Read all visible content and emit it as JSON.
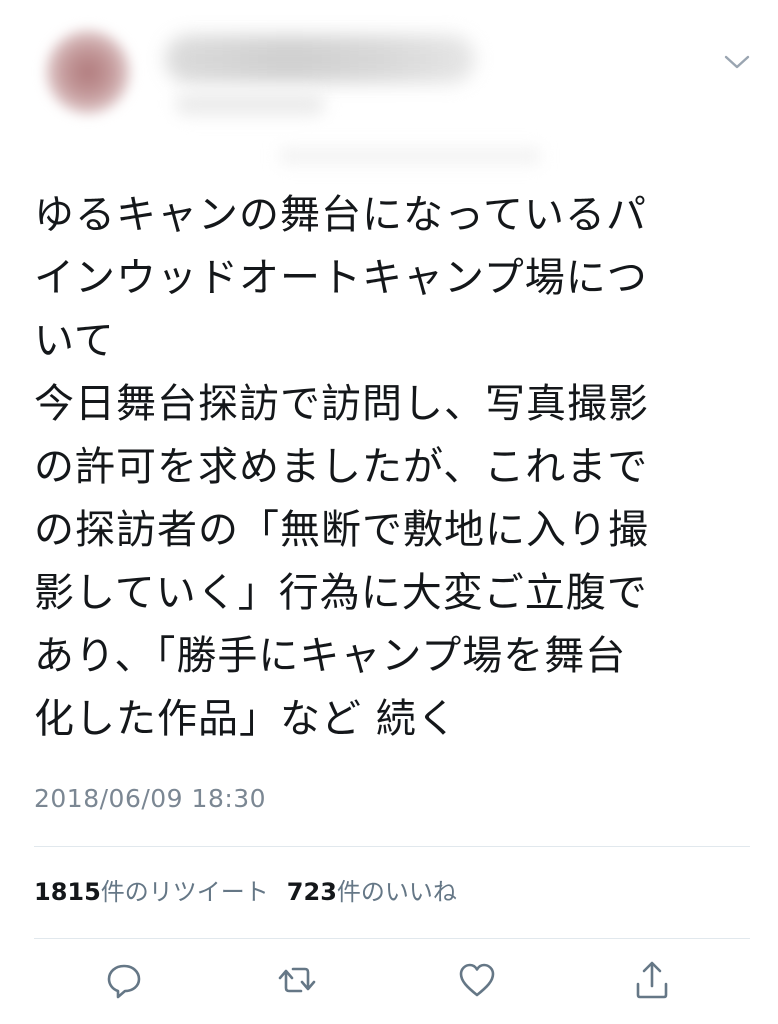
{
  "header": {
    "avatar_icon": "avatar-icon",
    "menu_icon": "chevron-down-icon"
  },
  "tweet": {
    "lines": [
      "ゆるキャンの舞台になっているパ",
      "インウッドオートキャンプ場につ",
      "いて",
      "今日舞台探訪で訪問し、写真撮影",
      "の許可を求めましたが、これまで",
      "の探訪者の「無断で敷地に入り撮",
      "影していく」行為に大変ご立腹で",
      "あり、「勝手にキャンプ場を舞台",
      "化した作品」など 続く"
    ],
    "timestamp": "2018/06/09 18:30"
  },
  "stats": {
    "retweet_count": "1815",
    "retweet_label": "件のリツイート",
    "like_count": "723",
    "like_label": "件のいいね"
  },
  "actions": {
    "reply_icon": "reply-icon",
    "retweet_icon": "retweet-icon",
    "like_icon": "heart-icon",
    "share_icon": "share-icon"
  },
  "colors": {
    "text": "#14171a",
    "muted": "#657786",
    "timestamp": "#7b8793",
    "divider": "#e1e8ed",
    "icon": "#657786"
  }
}
